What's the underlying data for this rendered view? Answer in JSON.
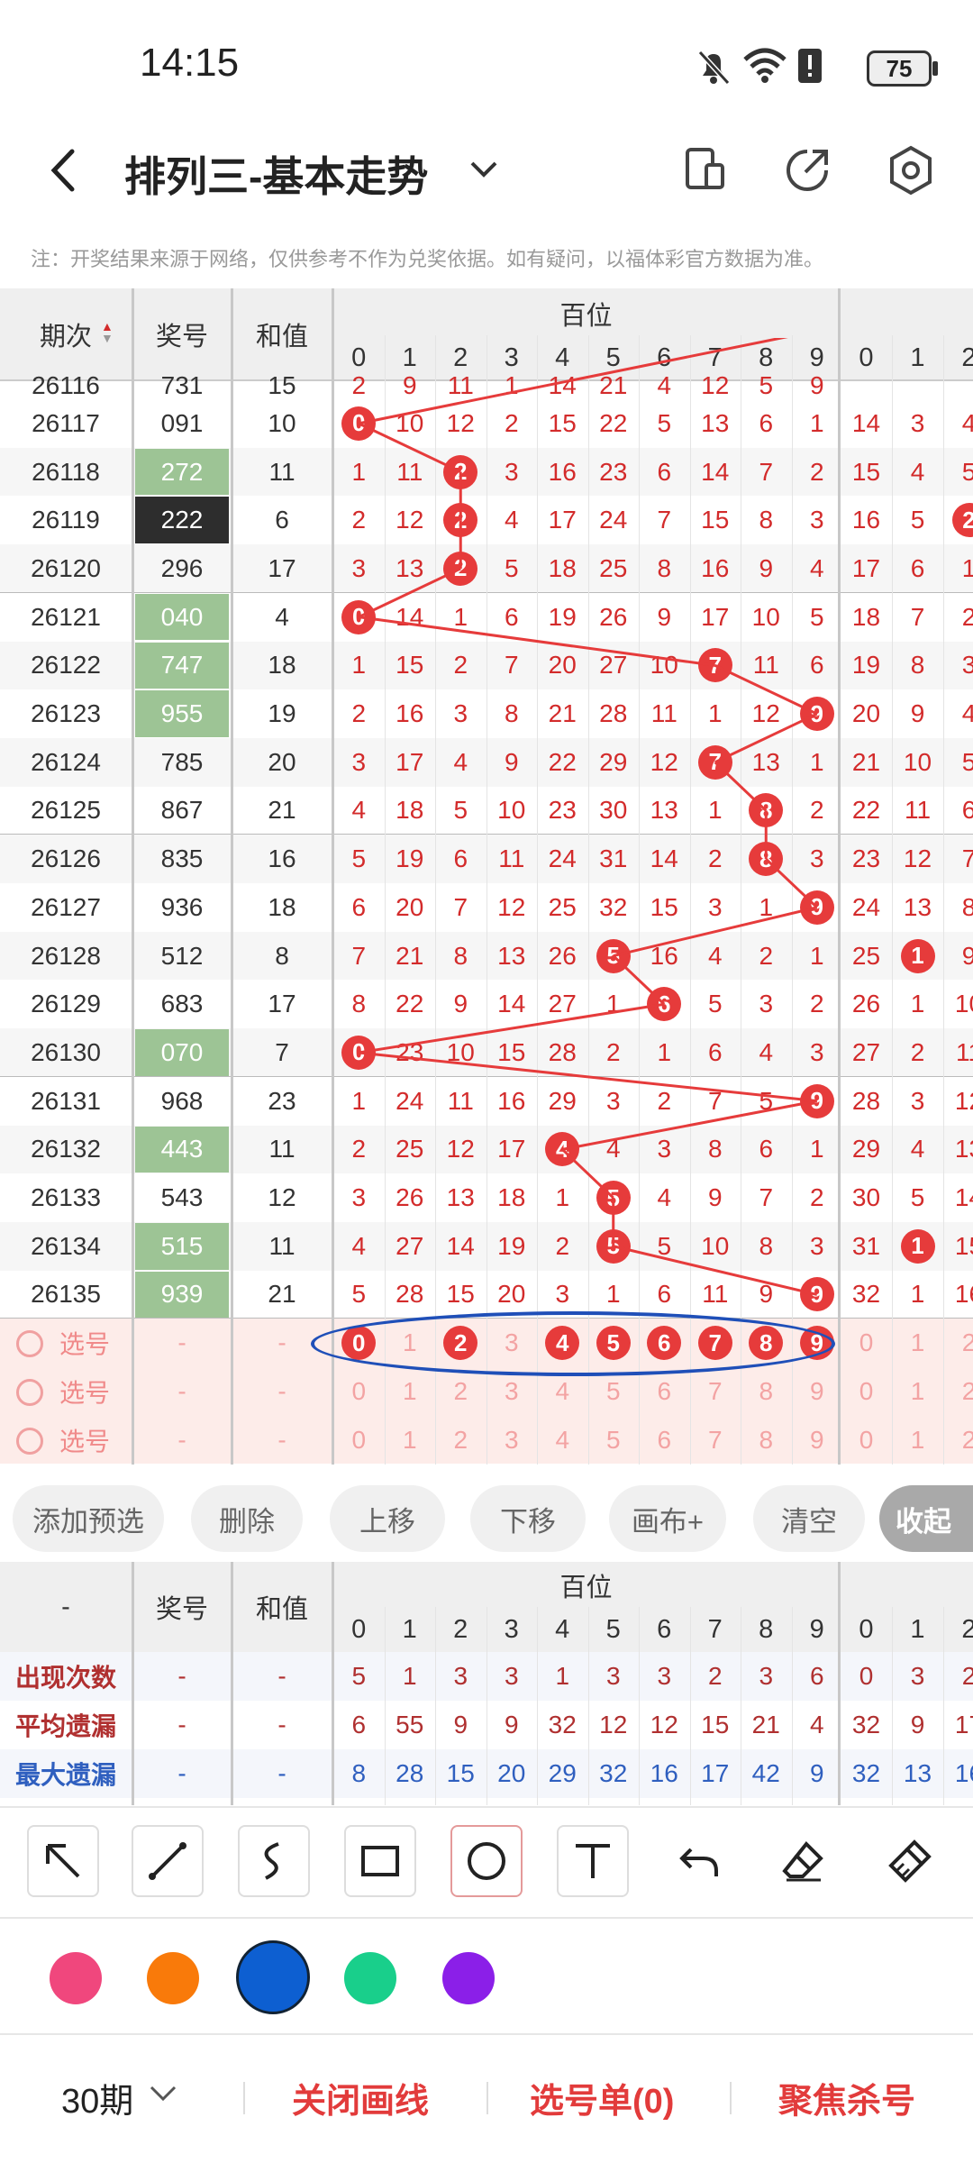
{
  "status": {
    "time": "14:15",
    "battery": "75"
  },
  "header": {
    "back_icon": "chevron-left-icon",
    "title": "排列三-基本走势",
    "title_dropdown_icon": "chevron-down-icon",
    "icons": [
      "layout-icon",
      "share-icon",
      "settings-hex-icon"
    ]
  },
  "notice": "注：开奖结果来源于网络，仅供参考不作为兑奖依据。如有疑问，以福体彩官方数据为准。",
  "table": {
    "col_period": "期次",
    "col_prize": "奖号",
    "col_sum": "和值",
    "group_hundreds": "百位",
    "digits": [
      "0",
      "1",
      "2",
      "3",
      "4",
      "5",
      "6",
      "7",
      "8",
      "9"
    ],
    "sort_icon": "sort-triangles-icon",
    "accent_color": "#e63b3b",
    "partial_top_row": {
      "period": "26116",
      "prize": "731",
      "sum": "15",
      "hundreds": [
        "2",
        "9",
        "11",
        "1",
        "14",
        "21",
        "4",
        "12",
        "5",
        "9"
      ],
      "tens_partial": [
        "",
        "",
        ""
      ]
    },
    "rows": [
      {
        "period": "26117",
        "prize": "091",
        "sum": "10",
        "prize_style": "plain",
        "hundreds": [
          "0",
          "10",
          "12",
          "2",
          "15",
          "22",
          "5",
          "13",
          "6",
          "1"
        ],
        "tens": [
          "14",
          "3",
          "4"
        ]
      },
      {
        "period": "26118",
        "prize": "272",
        "sum": "11",
        "prize_style": "green",
        "hundreds": [
          "1",
          "11",
          "2",
          "3",
          "16",
          "23",
          "6",
          "14",
          "7",
          "2"
        ],
        "tens": [
          "15",
          "4",
          "5"
        ]
      },
      {
        "period": "26119",
        "prize": "222",
        "sum": "6",
        "prize_style": "black",
        "hundreds": [
          "2",
          "12",
          "2",
          "4",
          "17",
          "24",
          "7",
          "15",
          "8",
          "3"
        ],
        "tens": [
          "16",
          "5",
          "2"
        ]
      },
      {
        "period": "26120",
        "prize": "296",
        "sum": "17",
        "prize_style": "plain",
        "hundreds": [
          "3",
          "13",
          "2",
          "5",
          "18",
          "25",
          "8",
          "16",
          "9",
          "4"
        ],
        "tens": [
          "17",
          "6",
          "1"
        ]
      },
      {
        "period": "26121",
        "prize": "040",
        "sum": "4",
        "prize_style": "green",
        "hundreds": [
          "0",
          "14",
          "1",
          "6",
          "19",
          "26",
          "9",
          "17",
          "10",
          "5"
        ],
        "tens": [
          "18",
          "7",
          "2"
        ]
      },
      {
        "period": "26122",
        "prize": "747",
        "sum": "18",
        "prize_style": "green",
        "hundreds": [
          "1",
          "15",
          "2",
          "7",
          "20",
          "27",
          "10",
          "7",
          "11",
          "6"
        ],
        "tens": [
          "19",
          "8",
          "3"
        ]
      },
      {
        "period": "26123",
        "prize": "955",
        "sum": "19",
        "prize_style": "green",
        "hundreds": [
          "2",
          "16",
          "3",
          "8",
          "21",
          "28",
          "11",
          "1",
          "12",
          "9"
        ],
        "tens": [
          "20",
          "9",
          "4"
        ]
      },
      {
        "period": "26124",
        "prize": "785",
        "sum": "20",
        "prize_style": "plain",
        "hundreds": [
          "3",
          "17",
          "4",
          "9",
          "22",
          "29",
          "12",
          "7",
          "13",
          "1"
        ],
        "tens": [
          "21",
          "10",
          "5"
        ]
      },
      {
        "period": "26125",
        "prize": "867",
        "sum": "21",
        "prize_style": "plain",
        "hundreds": [
          "4",
          "18",
          "5",
          "10",
          "23",
          "30",
          "13",
          "1",
          "8",
          "2"
        ],
        "tens": [
          "22",
          "11",
          "6"
        ]
      },
      {
        "period": "26126",
        "prize": "835",
        "sum": "16",
        "prize_style": "plain",
        "hundreds": [
          "5",
          "19",
          "6",
          "11",
          "24",
          "31",
          "14",
          "2",
          "8",
          "3"
        ],
        "tens": [
          "23",
          "12",
          "7"
        ]
      },
      {
        "period": "26127",
        "prize": "936",
        "sum": "18",
        "prize_style": "plain",
        "hundreds": [
          "6",
          "20",
          "7",
          "12",
          "25",
          "32",
          "15",
          "3",
          "1",
          "9"
        ],
        "tens": [
          "24",
          "13",
          "8"
        ]
      },
      {
        "period": "26128",
        "prize": "512",
        "sum": "8",
        "prize_style": "plain",
        "hundreds": [
          "7",
          "21",
          "8",
          "13",
          "26",
          "5",
          "16",
          "4",
          "2",
          "1"
        ],
        "tens": [
          "25",
          "1",
          "9"
        ]
      },
      {
        "period": "26129",
        "prize": "683",
        "sum": "17",
        "prize_style": "plain",
        "hundreds": [
          "8",
          "22",
          "9",
          "14",
          "27",
          "1",
          "6",
          "5",
          "3",
          "2"
        ],
        "tens": [
          "26",
          "1",
          "10"
        ]
      },
      {
        "period": "26130",
        "prize": "070",
        "sum": "7",
        "prize_style": "green",
        "hundreds": [
          "0",
          "23",
          "10",
          "15",
          "28",
          "2",
          "1",
          "6",
          "4",
          "3"
        ],
        "tens": [
          "27",
          "2",
          "11"
        ]
      },
      {
        "period": "26131",
        "prize": "968",
        "sum": "23",
        "prize_style": "plain",
        "hundreds": [
          "1",
          "24",
          "11",
          "16",
          "29",
          "3",
          "2",
          "7",
          "5",
          "9"
        ],
        "tens": [
          "28",
          "3",
          "12"
        ]
      },
      {
        "period": "26132",
        "prize": "443",
        "sum": "11",
        "prize_style": "green",
        "hundreds": [
          "2",
          "25",
          "12",
          "17",
          "4",
          "4",
          "3",
          "8",
          "6",
          "1"
        ],
        "tens": [
          "29",
          "4",
          "13"
        ]
      },
      {
        "period": "26133",
        "prize": "543",
        "sum": "12",
        "prize_style": "plain",
        "hundreds": [
          "3",
          "26",
          "13",
          "18",
          "1",
          "5",
          "4",
          "9",
          "7",
          "2"
        ],
        "tens": [
          "30",
          "5",
          "14"
        ]
      },
      {
        "period": "26134",
        "prize": "515",
        "sum": "11",
        "prize_style": "green",
        "hundreds": [
          "4",
          "27",
          "14",
          "19",
          "2",
          "5",
          "5",
          "10",
          "8",
          "3"
        ],
        "tens": [
          "31",
          "1",
          "15"
        ]
      },
      {
        "period": "26135",
        "prize": "939",
        "sum": "21",
        "prize_style": "green",
        "hundreds": [
          "5",
          "28",
          "15",
          "20",
          "3",
          "1",
          "6",
          "11",
          "9",
          "9"
        ],
        "tens": [
          "32",
          "1",
          "16"
        ]
      }
    ],
    "hit_columns": [
      0,
      2,
      2,
      2,
      0,
      7,
      9,
      7,
      8,
      8,
      9,
      5,
      6,
      0,
      9,
      4,
      5,
      5,
      9
    ],
    "tens_hits": {
      "row11": 1,
      "row17": 1,
      "row2": 2
    },
    "pick_rows": [
      {
        "label": "选号",
        "prize": "-",
        "sum": "-",
        "digits": [
          "0",
          "1",
          "2",
          "3",
          "4",
          "5",
          "6",
          "7",
          "8",
          "9"
        ],
        "selected": [
          0,
          2,
          4,
          5,
          6,
          7,
          8,
          9
        ],
        "tens": [
          "0",
          "1",
          "2"
        ]
      },
      {
        "label": "选号",
        "prize": "-",
        "sum": "-",
        "digits": [
          "0",
          "1",
          "2",
          "3",
          "4",
          "5",
          "6",
          "7",
          "8",
          "9"
        ],
        "selected": [],
        "tens": [
          "0",
          "1",
          "2"
        ]
      },
      {
        "label": "选号",
        "prize": "-",
        "sum": "-",
        "digits": [
          "0",
          "1",
          "2",
          "3",
          "4",
          "5",
          "6",
          "7",
          "8",
          "9"
        ],
        "selected": [],
        "tens": [
          "0",
          "1",
          "2"
        ]
      }
    ]
  },
  "actions": {
    "add": "添加预选",
    "delete": "删除",
    "up": "上移",
    "down": "下移",
    "canvas": "画布+",
    "clear": "清空",
    "collapse": "收起"
  },
  "stats": {
    "dash": "-",
    "col_prize": "奖号",
    "col_sum": "和值",
    "group_hundreds": "百位",
    "rows": [
      {
        "label": "出现次数",
        "prize": "-",
        "sum": "-",
        "hundreds": [
          "5",
          "1",
          "3",
          "3",
          "1",
          "3",
          "3",
          "2",
          "3",
          "6"
        ],
        "tens": [
          "0",
          "3",
          "2"
        ],
        "color": "#b03030"
      },
      {
        "label": "平均遗漏",
        "prize": "-",
        "sum": "-",
        "hundreds": [
          "6",
          "55",
          "9",
          "9",
          "32",
          "12",
          "12",
          "15",
          "21",
          "4"
        ],
        "tens": [
          "32",
          "9",
          "17"
        ],
        "color": "#b03030"
      },
      {
        "label": "最大遗漏",
        "prize": "-",
        "sum": "-",
        "hundreds": [
          "8",
          "28",
          "15",
          "20",
          "29",
          "32",
          "16",
          "17",
          "42",
          "9"
        ],
        "tens": [
          "32",
          "13",
          "16"
        ],
        "color": "#2f5fbf"
      }
    ]
  },
  "drawing_tools": [
    "arrow-tool-icon",
    "line-tool-icon",
    "curve-tool-icon",
    "rectangle-tool-icon",
    "circle-tool-icon",
    "text-tool-icon",
    "undo-icon",
    "eraser-icon",
    "brush-clear-icon"
  ],
  "palette": [
    "#f0477d",
    "#f97a0a",
    "#0d5fd1",
    "#19cf8b",
    "#8b1fe8"
  ],
  "bottom": {
    "period_select": "30期",
    "close_lines": "关闭画线",
    "pick_list": "选号单(0)",
    "focus": "聚焦杀号"
  }
}
